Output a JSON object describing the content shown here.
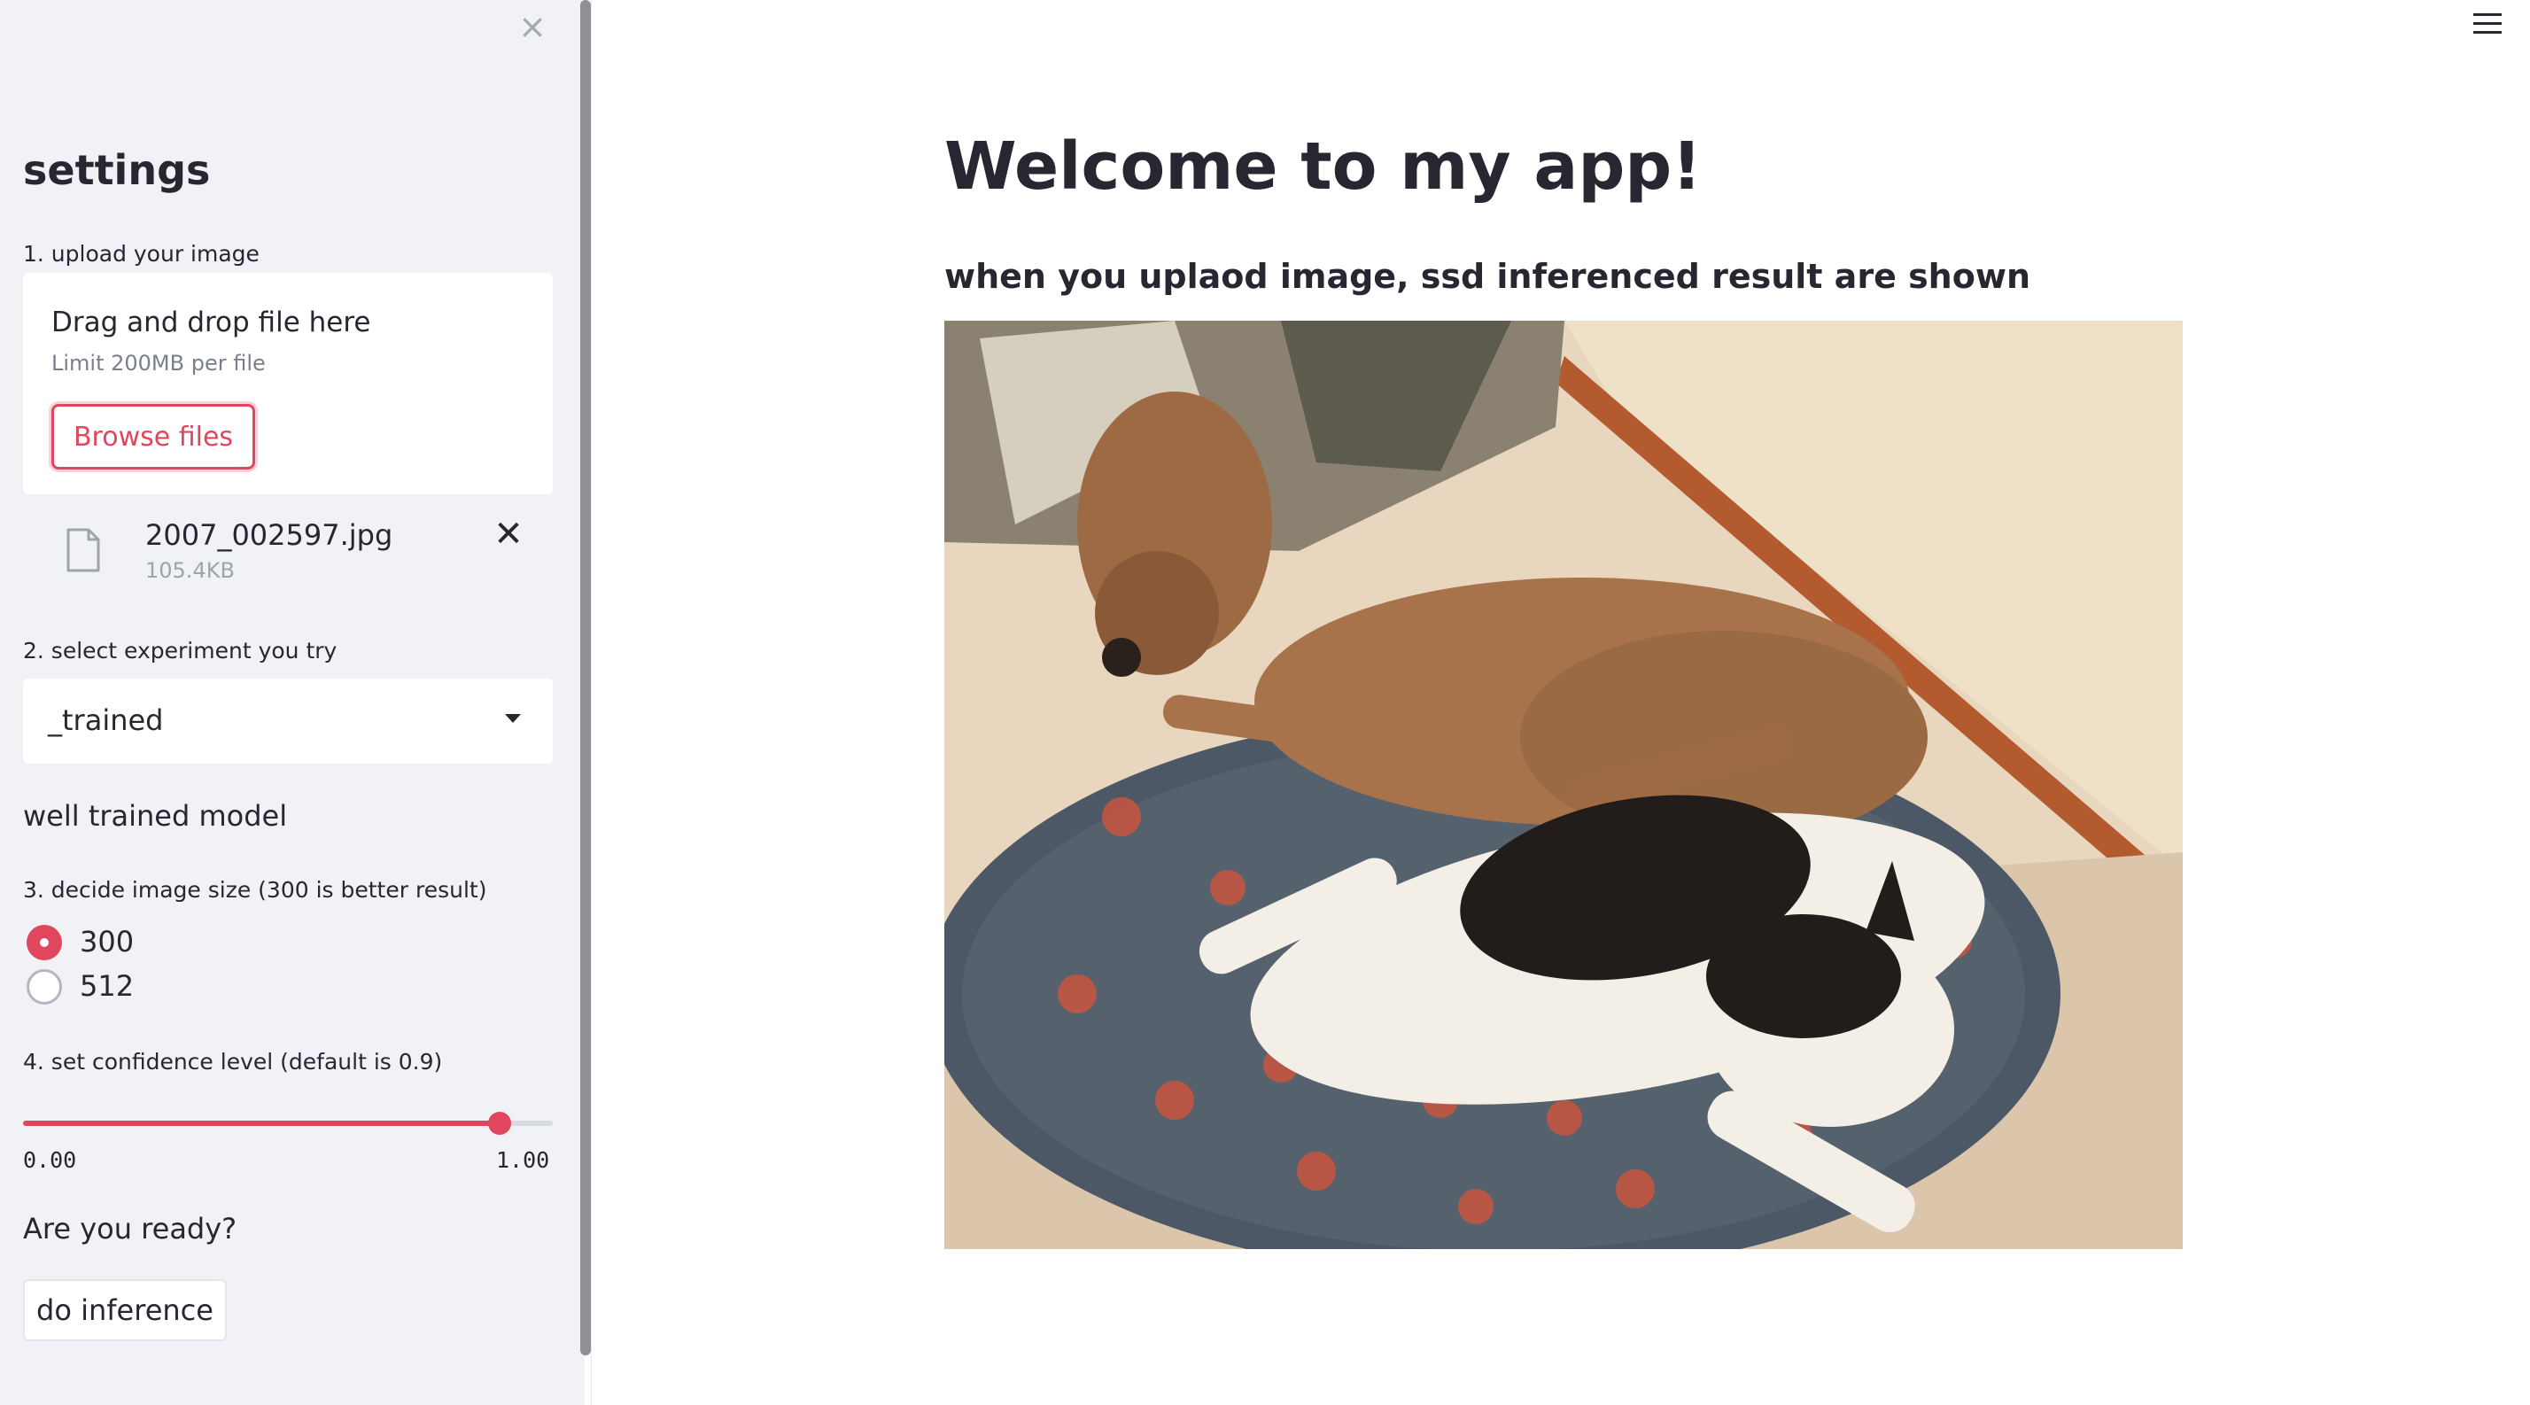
{
  "sidebar": {
    "title": "settings",
    "close_icon": "close-icon",
    "upload": {
      "label": "1. upload your image",
      "drag_text": "Drag and drop file here",
      "limit_text": "Limit 200MB per file",
      "browse_label": "Browse files",
      "file": {
        "name": "2007_002597.jpg",
        "size": "105.4KB",
        "icon": "file-icon"
      }
    },
    "experiment": {
      "label": "2. select experiment you try",
      "selected": "_trained",
      "description": "well trained model"
    },
    "image_size": {
      "label": "3. decide image size (300 is better result)",
      "options": [
        {
          "label": "300",
          "checked": true
        },
        {
          "label": "512",
          "checked": false
        }
      ]
    },
    "confidence": {
      "label": "4. set confidence level (default is 0.9)",
      "min_label": "0.00",
      "max_label": "1.00",
      "value": 0.9
    },
    "ready_text": "Are you ready?",
    "inference_label": "do inference"
  },
  "main": {
    "title": "Welcome to my app!",
    "subtitle": "when you uplaod image, ssd inferenced result are shown",
    "image_subject": "photo of a brindle dog and a black-and-white cat on a patterned cushion"
  },
  "colors": {
    "accent": "#e0465e",
    "sidebar_bg": "#f0f2f6",
    "text": "#262730"
  }
}
